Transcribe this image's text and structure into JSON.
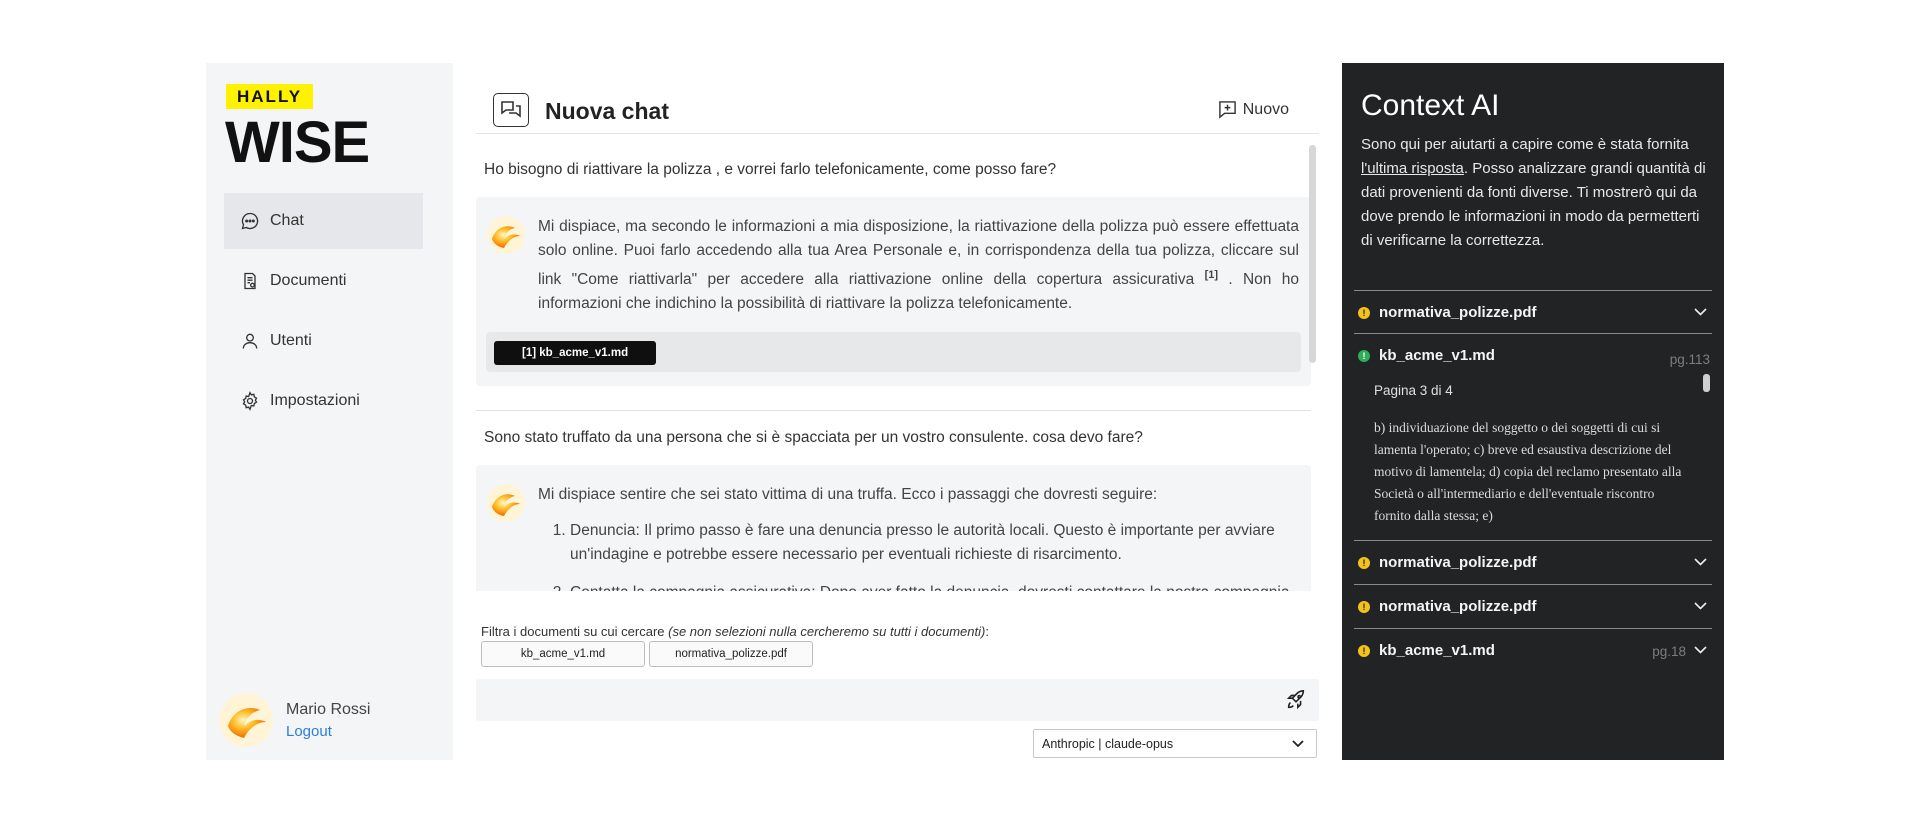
{
  "brand": {
    "top": "HALLY",
    "bottom": "WISE",
    "accent": "#fff200"
  },
  "sidebar": {
    "items": [
      {
        "label": "Chat",
        "icon": "chat-bubble-icon",
        "active": true
      },
      {
        "label": "Documenti",
        "icon": "document-icon",
        "active": false
      },
      {
        "label": "Utenti",
        "icon": "user-icon",
        "active": false
      },
      {
        "label": "Impostazioni",
        "icon": "gear-icon",
        "active": false
      }
    ],
    "user": {
      "name": "Mario Rossi",
      "logout": "Logout"
    }
  },
  "chat": {
    "title": "Nuova chat",
    "new_label": "Nuovo",
    "messages": [
      {
        "question": "Ho bisogno di riattivare la polizza , e vorrei farlo telefonicamente, come posso fare?",
        "answer_before_cite": "Mi dispiace, ma secondo le informazioni a mia disposizione, la riattivazione della polizza può essere effettuata solo online. Puoi farlo accedendo alla tua Area Personale e, in corrispondenza della tua polizza, cliccare sul link \"Come riattivarla\" per accedere alla riattivazione online della copertura assicurativa ",
        "cite_marker": "[1]",
        "answer_after_cite": " . Non ho informazioni che indichino la possibilità di riattivare la polizza telefonicamente.",
        "citation": "[1] kb_acme_v1.md"
      },
      {
        "question": "Sono stato truffato da una persona che si è spacciata per un vostro consulente. cosa devo fare?",
        "answer_intro": "Mi dispiace sentire che sei stato vittima di una truffa. Ecco i passaggi che dovresti seguire:",
        "steps": [
          "Denuncia: Il primo passo è fare una denuncia presso le autorità locali. Questo è importante per avviare un'indagine e potrebbe essere necessario per eventuali richieste di risarcimento.",
          "Contatta la compagnia assicurativa: Dopo aver fatto la denuncia, dovresti contattare la nostra compagnia per segnalare l'accaduto."
        ]
      }
    ],
    "filter": {
      "label": "Filtra i documenti su cui cercare ",
      "hint": "(se non selezioni nulla cercheremo su tutti i documenti)",
      "colon": ":",
      "chips": [
        "kb_acme_v1.md",
        "normativa_polizze.pdf"
      ]
    },
    "input_placeholder": "",
    "model": "Anthropic | claude-opus"
  },
  "context": {
    "title": "Context AI",
    "desc_before": "Sono qui per aiutarti a capire come è stata fornita ",
    "desc_link": "l'ultima risposta",
    "desc_after": ". Posso analizzare grandi quantità di dati provenienti da fonti diverse. Ti mostrerò qui da dove prendo le informazioni in modo da permetterti di verificarne la correttezza.",
    "sources": [
      {
        "name": "normativa_polizze.pdf",
        "status": "warning",
        "page": ""
      },
      {
        "name": "kb_acme_v1.md",
        "status": "ok",
        "page": "pg.113",
        "page_of": "Pagina 3 di 4",
        "excerpt": "b) individuazione del soggetto o dei soggetti di cui si lamenta l'operato; c) breve ed esaustiva descrizione del motivo di lamentela; d) copia del reclamo presentato alla Società o all'intermediario e dell'eventuale riscontro fornito dalla stessa; e)"
      },
      {
        "name": "normativa_polizze.pdf",
        "status": "warning",
        "page": ""
      },
      {
        "name": "normativa_polizze.pdf",
        "status": "warning",
        "page": ""
      },
      {
        "name": "kb_acme_v1.md",
        "status": "warning",
        "page": "pg.18"
      }
    ],
    "status_colors": {
      "warning": "#f4c21a",
      "ok": "#2fae57"
    }
  }
}
